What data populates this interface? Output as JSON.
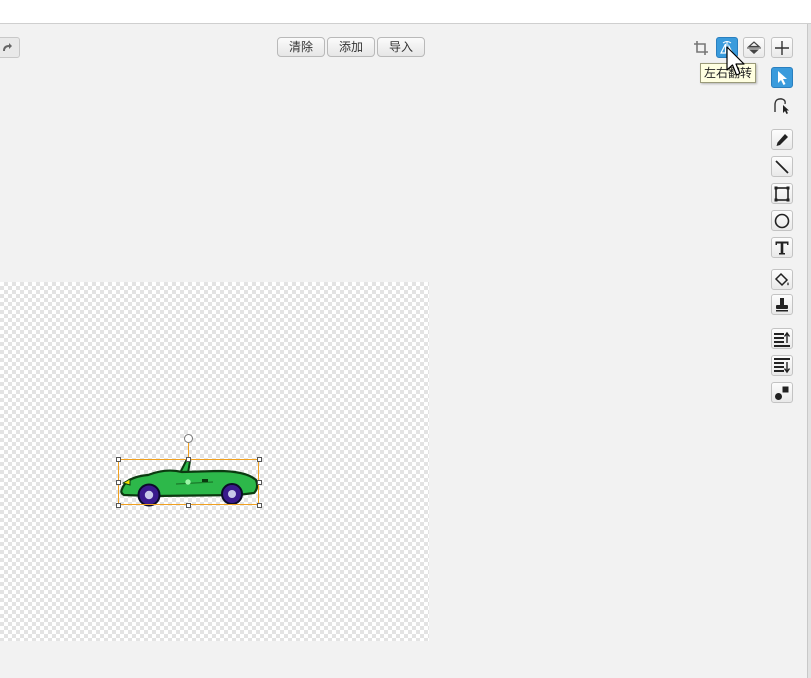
{
  "toolbar": {
    "clear_label": "清除",
    "add_label": "添加",
    "import_label": "导入"
  },
  "tooltip": {
    "text": "左右翻转"
  },
  "top_tools": [
    {
      "icon": "crop-icon",
      "state": "flat"
    },
    {
      "icon": "flip-horizontal-icon",
      "state": "active"
    },
    {
      "icon": "flip-vertical-icon",
      "state": "normal"
    },
    {
      "icon": "set-center-icon",
      "state": "normal"
    }
  ],
  "side_tools": [
    {
      "icon": "select-arrow-icon",
      "state": "active"
    },
    {
      "icon": "reshape-icon",
      "state": "normal"
    },
    {
      "icon": "pencil-icon",
      "state": "normal"
    },
    {
      "icon": "line-icon",
      "state": "normal"
    },
    {
      "icon": "rectangle-icon",
      "state": "normal"
    },
    {
      "icon": "ellipse-icon",
      "state": "normal"
    },
    {
      "icon": "text-icon",
      "state": "normal"
    },
    {
      "icon": "fill-bucket-icon",
      "state": "normal"
    },
    {
      "icon": "stamp-icon",
      "state": "normal"
    },
    {
      "icon": "bring-forward-icon",
      "state": "normal"
    },
    {
      "icon": "send-backward-icon",
      "state": "normal"
    },
    {
      "icon": "ungroup-icon",
      "state": "normal"
    }
  ],
  "colors": {
    "accent": "#3a9bdc",
    "selection": "#f0a020",
    "car_body": "#2db84a",
    "car_wheel": "#3a1a8c"
  }
}
